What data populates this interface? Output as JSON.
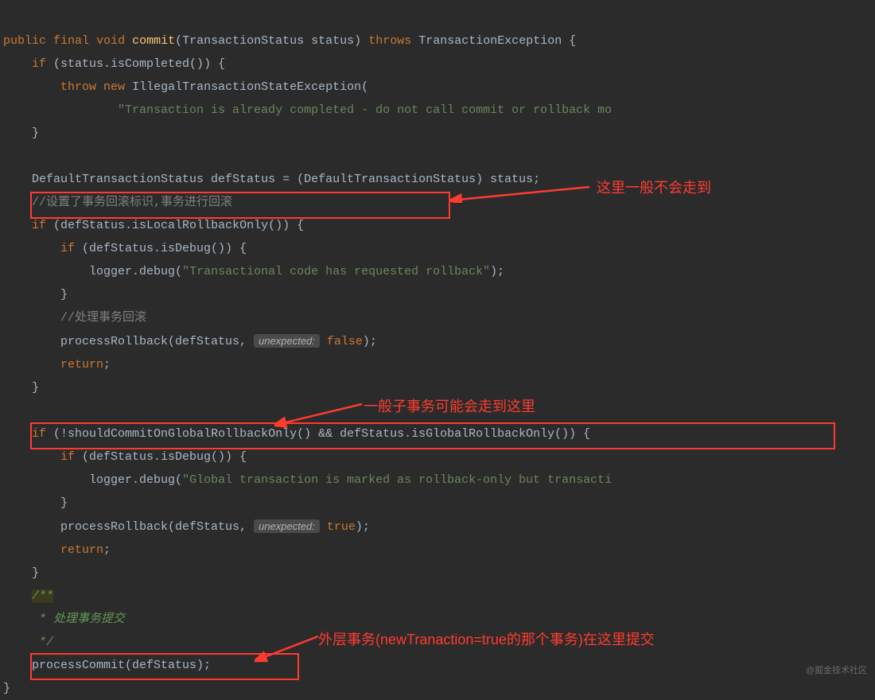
{
  "code": {
    "l1_public": "public",
    "l1_final": "final",
    "l1_void": "void",
    "l1_method": "commit",
    "l1_paren_open": "(",
    "l1_param_type": "TransactionStatus",
    "l1_param_name": " status",
    "l1_paren_close": ") ",
    "l1_throws": "throws",
    "l1_exception": " TransactionException {",
    "l2_if": "if",
    "l2_cond": " (status.isCompleted()) {",
    "l3_throw": "throw",
    "l3_new": "new",
    "l3_exc": " IllegalTransactionStateException(",
    "l4_str": "\"Transaction is already completed - do not call commit or rollback mo",
    "l5_close": "}",
    "l7_line": "DefaultTransactionStatus defStatus = (DefaultTransactionStatus) status;",
    "l8_cmt": "//设置了事务回滚标识,事务进行回滚",
    "l9_if": "if",
    "l9_cond": " (defStatus.isLocalRollbackOnly()) {",
    "l10_if": "if",
    "l10_cond": " (defStatus.isDebug()) {",
    "l11_call": "logger.debug(",
    "l11_str": "\"Transactional code has requested rollback\"",
    "l11_end": ");",
    "l12_close": "}",
    "l13_cmt": "//处理事务回滚",
    "l14_call": "processRollback(defStatus, ",
    "l14_hint": "unexpected:",
    "l14_val": " false",
    "l14_end": ");",
    "l15_return": "return",
    "l15_semi": ";",
    "l16_close": "}",
    "l18_if": "if",
    "l18_cond": " (!shouldCommitOnGlobalRollbackOnly() && defStatus.isGlobalRollbackOnly())",
    "l18_brace": " {",
    "l19_if": "if",
    "l19_cond": " (defStatus.isDebug()) {",
    "l20_call": "logger.debug(",
    "l20_str": "\"Global transaction is marked as rollback-only but transacti",
    "l21_close": "}",
    "l22_call": "processRollback(defStatus, ",
    "l22_hint": "unexpected:",
    "l22_val": " true",
    "l22_end": ");",
    "l23_return": "return",
    "l23_semi": ";",
    "l24_close": "}",
    "l25_cmt_open": "/**",
    "l26_cmt": " * 处理事务提交",
    "l27_cmt_close": " */",
    "l28_call": "processCommit(defStatus);",
    "l29_close": "}"
  },
  "annotations": {
    "a1": "这里一般不会走到",
    "a2": "一般子事务可能会走到这里",
    "a3": "外层事务(newTranaction=true的那个事务)在这里提交"
  },
  "watermark": "@掘金技术社区"
}
